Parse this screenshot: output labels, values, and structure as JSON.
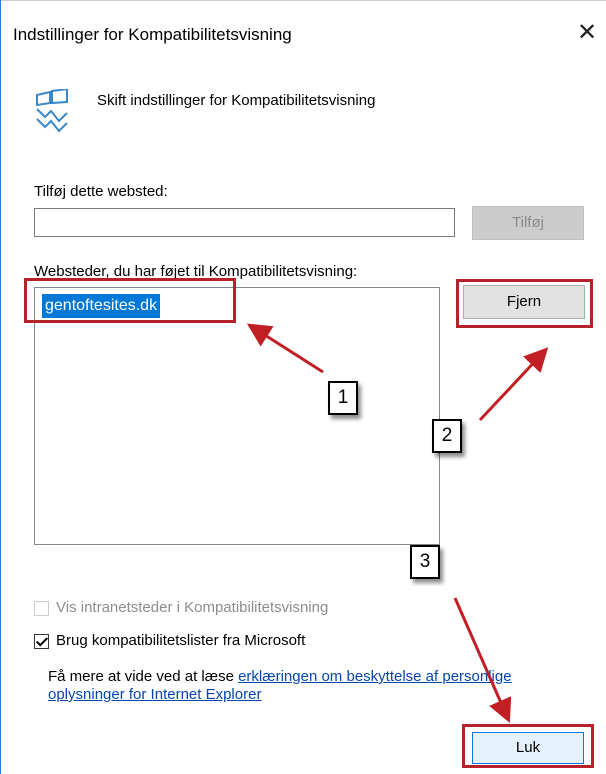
{
  "window": {
    "title": "Indstillinger for Kompatibilitetsvisning",
    "close_glyph": "✕"
  },
  "header": {
    "text": "Skift indstillinger for Kompatibilitetsvisning",
    "icon": "compatibility-view-icon"
  },
  "add_site": {
    "label": "Tilføj dette websted:",
    "value": "",
    "placeholder": "",
    "button_label": "Tilføj"
  },
  "sites": {
    "label": "Websteder, du har føjet til Kompatibilitetsvisning:",
    "items": [
      "gentoftesites.dk"
    ],
    "remove_label": "Fjern"
  },
  "options": {
    "intranet": {
      "label": "Vis intranetsteder i Kompatibilitetsvisning",
      "checked": false,
      "disabled": true
    },
    "microsoft_lists": {
      "label": "Brug kompatibilitetslister fra Microsoft",
      "checked": true
    }
  },
  "info": {
    "prefix": "Få mere at vide ved at læse ",
    "link_line1": "erklæringen om beskyttelse af personlige",
    "link_line2": "oplysninger for Internet Explorer"
  },
  "close_button": {
    "label": "Luk"
  },
  "annotations": {
    "callouts": [
      "1",
      "2",
      "3"
    ],
    "highlight_color": "#b5222a",
    "arrow_color": "#c21f24"
  },
  "colors": {
    "accent": "#0078d7",
    "window_border": "#2b79d8"
  }
}
